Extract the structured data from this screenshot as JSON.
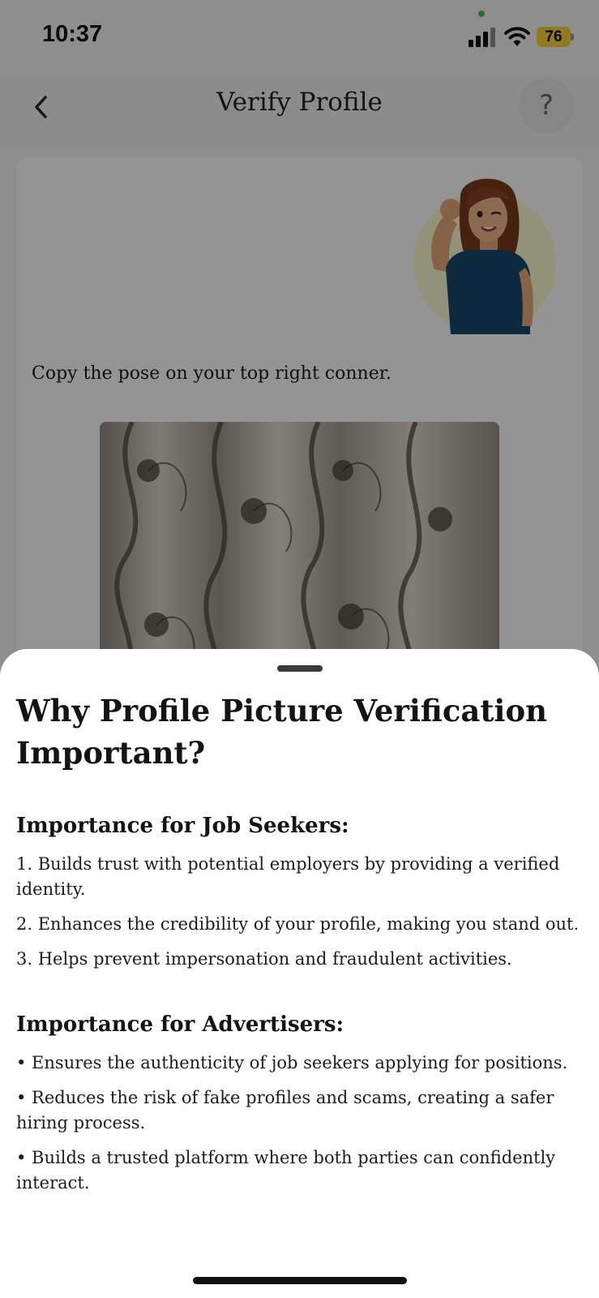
{
  "status_bar": {
    "time": "10:37",
    "battery_level": "76",
    "battery_color": "#f8d33b",
    "icons": [
      "signal-icon",
      "wifi-icon",
      "battery-icon"
    ]
  },
  "nav": {
    "title": "Verify Profile",
    "back_icon": "chevron-left-icon",
    "help_label": "?"
  },
  "card": {
    "instruction": "Copy the pose on your top right conner.",
    "avatar": "pose-avatar-illustration",
    "photo": "captured-photo-preview"
  },
  "sheet": {
    "title": "Why Profile Picture Verification Important?",
    "job_seekers": {
      "heading": "Importance for Job Seekers:",
      "items": [
        "1. Builds trust with potential employers by providing a verified identity.",
        "2. Enhances the credibility of your profile, making you stand out.",
        "3. Helps prevent impersonation and fraudulent activities."
      ]
    },
    "advertisers": {
      "heading": "Importance for Advertisers:",
      "items": [
        "• Ensures the authenticity of job seekers applying for positions.",
        "• Reduces the risk of fake profiles and scams, creating a safer hiring process.",
        "• Builds a trusted platform where both parties can confidently interact."
      ]
    }
  },
  "colors": {
    "overlay": "rgba(0,0,0,0.42)",
    "sheet_background": "#ffffff",
    "avatar_shirt": "#17486b",
    "avatar_hair": "#7a3a1c"
  }
}
